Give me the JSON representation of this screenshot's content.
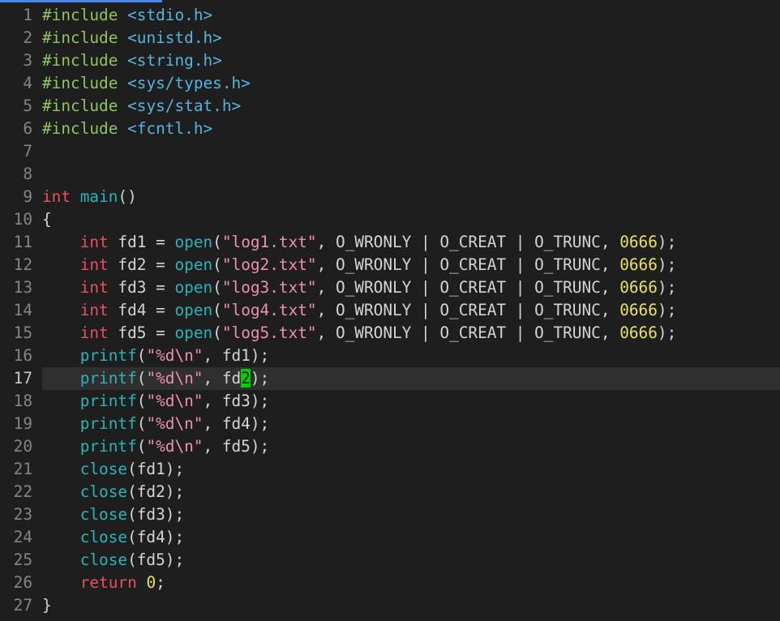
{
  "colors": {
    "background": "#1e1e1e",
    "current_line": "#2f2f2f",
    "cursor": "#00d000",
    "line_number": "#858585",
    "preprocessor": "#8fc65b",
    "include_path": "#56b4e0",
    "keyword": "#e8505b",
    "function": "#2bb5b8",
    "string": "#f08fb4",
    "number": "#e8e06a",
    "plain": "#d4d4d4"
  },
  "editor": {
    "current_line": 17,
    "lines": [
      {
        "num": "1",
        "tokens": [
          [
            "pre",
            "#include"
          ],
          [
            "plain",
            " "
          ],
          [
            "inc",
            "<stdio.h>"
          ]
        ]
      },
      {
        "num": "2",
        "tokens": [
          [
            "pre",
            "#include"
          ],
          [
            "plain",
            " "
          ],
          [
            "inc",
            "<unistd.h>"
          ]
        ]
      },
      {
        "num": "3",
        "tokens": [
          [
            "pre",
            "#include"
          ],
          [
            "plain",
            " "
          ],
          [
            "inc",
            "<string.h>"
          ]
        ]
      },
      {
        "num": "4",
        "tokens": [
          [
            "pre",
            "#include"
          ],
          [
            "plain",
            " "
          ],
          [
            "inc",
            "<sys/types.h>"
          ]
        ]
      },
      {
        "num": "5",
        "tokens": [
          [
            "pre",
            "#include"
          ],
          [
            "plain",
            " "
          ],
          [
            "inc",
            "<sys/stat.h>"
          ]
        ]
      },
      {
        "num": "6",
        "tokens": [
          [
            "pre",
            "#include"
          ],
          [
            "plain",
            " "
          ],
          [
            "inc",
            "<fcntl.h>"
          ]
        ]
      },
      {
        "num": "7",
        "tokens": []
      },
      {
        "num": "8",
        "tokens": []
      },
      {
        "num": "9",
        "tokens": [
          [
            "kw",
            "int"
          ],
          [
            "plain",
            " "
          ],
          [
            "fn",
            "main"
          ],
          [
            "plain",
            "()"
          ]
        ]
      },
      {
        "num": "10",
        "tokens": [
          [
            "plain",
            "{"
          ]
        ]
      },
      {
        "num": "11",
        "tokens": [
          [
            "plain",
            "    "
          ],
          [
            "kw",
            "int"
          ],
          [
            "plain",
            " fd1 = "
          ],
          [
            "fn",
            "open"
          ],
          [
            "plain",
            "("
          ],
          [
            "str",
            "\"log1.txt\""
          ],
          [
            "plain",
            ", O_WRONLY | O_CREAT | O_TRUNC, "
          ],
          [
            "num",
            "0666"
          ],
          [
            "plain",
            ");"
          ]
        ]
      },
      {
        "num": "12",
        "tokens": [
          [
            "plain",
            "    "
          ],
          [
            "kw",
            "int"
          ],
          [
            "plain",
            " fd2 = "
          ],
          [
            "fn",
            "open"
          ],
          [
            "plain",
            "("
          ],
          [
            "str",
            "\"log2.txt\""
          ],
          [
            "plain",
            ", O_WRONLY | O_CREAT | O_TRUNC, "
          ],
          [
            "num",
            "0666"
          ],
          [
            "plain",
            ");"
          ]
        ]
      },
      {
        "num": "13",
        "tokens": [
          [
            "plain",
            "    "
          ],
          [
            "kw",
            "int"
          ],
          [
            "plain",
            " fd3 = "
          ],
          [
            "fn",
            "open"
          ],
          [
            "plain",
            "("
          ],
          [
            "str",
            "\"log3.txt\""
          ],
          [
            "plain",
            ", O_WRONLY | O_CREAT | O_TRUNC, "
          ],
          [
            "num",
            "0666"
          ],
          [
            "plain",
            ");"
          ]
        ]
      },
      {
        "num": "14",
        "tokens": [
          [
            "plain",
            "    "
          ],
          [
            "kw",
            "int"
          ],
          [
            "plain",
            " fd4 = "
          ],
          [
            "fn",
            "open"
          ],
          [
            "plain",
            "("
          ],
          [
            "str",
            "\"log4.txt\""
          ],
          [
            "plain",
            ", O_WRONLY | O_CREAT | O_TRUNC, "
          ],
          [
            "num",
            "0666"
          ],
          [
            "plain",
            ");"
          ]
        ]
      },
      {
        "num": "15",
        "tokens": [
          [
            "plain",
            "    "
          ],
          [
            "kw",
            "int"
          ],
          [
            "plain",
            " fd5 = "
          ],
          [
            "fn",
            "open"
          ],
          [
            "plain",
            "("
          ],
          [
            "str",
            "\"log5.txt\""
          ],
          [
            "plain",
            ", O_WRONLY | O_CREAT | O_TRUNC, "
          ],
          [
            "num",
            "0666"
          ],
          [
            "plain",
            ");"
          ]
        ]
      },
      {
        "num": "16",
        "tokens": [
          [
            "plain",
            "    "
          ],
          [
            "fn",
            "printf"
          ],
          [
            "plain",
            "("
          ],
          [
            "str",
            "\"%d\\n\""
          ],
          [
            "plain",
            ", fd1);"
          ]
        ]
      },
      {
        "num": "17",
        "tokens": [
          [
            "plain",
            "    "
          ],
          [
            "fn",
            "printf"
          ],
          [
            "plain",
            "("
          ],
          [
            "str",
            "\"%d\\n\""
          ],
          [
            "plain",
            ", fd"
          ],
          [
            "cursor",
            "2"
          ],
          [
            "plain",
            ");"
          ]
        ]
      },
      {
        "num": "18",
        "tokens": [
          [
            "plain",
            "    "
          ],
          [
            "fn",
            "printf"
          ],
          [
            "plain",
            "("
          ],
          [
            "str",
            "\"%d\\n\""
          ],
          [
            "plain",
            ", fd3);"
          ]
        ]
      },
      {
        "num": "19",
        "tokens": [
          [
            "plain",
            "    "
          ],
          [
            "fn",
            "printf"
          ],
          [
            "plain",
            "("
          ],
          [
            "str",
            "\"%d\\n\""
          ],
          [
            "plain",
            ", fd4);"
          ]
        ]
      },
      {
        "num": "20",
        "tokens": [
          [
            "plain",
            "    "
          ],
          [
            "fn",
            "printf"
          ],
          [
            "plain",
            "("
          ],
          [
            "str",
            "\"%d\\n\""
          ],
          [
            "plain",
            ", fd5);"
          ]
        ]
      },
      {
        "num": "21",
        "tokens": [
          [
            "plain",
            "    "
          ],
          [
            "fn",
            "close"
          ],
          [
            "plain",
            "(fd1);"
          ]
        ]
      },
      {
        "num": "22",
        "tokens": [
          [
            "plain",
            "    "
          ],
          [
            "fn",
            "close"
          ],
          [
            "plain",
            "(fd2);"
          ]
        ]
      },
      {
        "num": "23",
        "tokens": [
          [
            "plain",
            "    "
          ],
          [
            "fn",
            "close"
          ],
          [
            "plain",
            "(fd3);"
          ]
        ]
      },
      {
        "num": "24",
        "tokens": [
          [
            "plain",
            "    "
          ],
          [
            "fn",
            "close"
          ],
          [
            "plain",
            "(fd4);"
          ]
        ]
      },
      {
        "num": "25",
        "tokens": [
          [
            "plain",
            "    "
          ],
          [
            "fn",
            "close"
          ],
          [
            "plain",
            "(fd5);"
          ]
        ]
      },
      {
        "num": "26",
        "tokens": [
          [
            "plain",
            "    "
          ],
          [
            "kw",
            "return"
          ],
          [
            "plain",
            " "
          ],
          [
            "num",
            "0"
          ],
          [
            "plain",
            ";"
          ]
        ]
      },
      {
        "num": "27",
        "tokens": [
          [
            "plain",
            "}"
          ]
        ]
      }
    ]
  }
}
